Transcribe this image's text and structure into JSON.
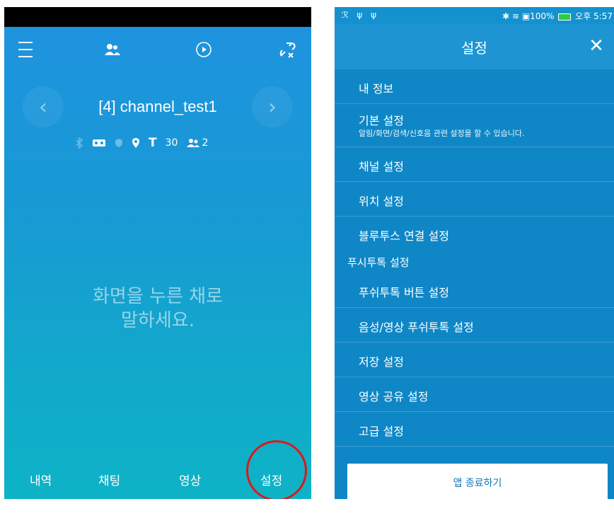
{
  "left": {
    "channel": "[4] channel_test1",
    "status": {
      "t_label": "T",
      "t_value": "30",
      "members": "2"
    },
    "prompt_line1": "화면을 누른 채로",
    "prompt_line2": "말하세요.",
    "tabs": [
      "내역",
      "채팅",
      "영상",
      "설정"
    ]
  },
  "right": {
    "statusbar": {
      "left": "ℛ ψ ψ",
      "right_pre": "✱ ≋ ▣100%",
      "right_post": "오후 5:57"
    },
    "title": "설정",
    "menu": [
      {
        "label": "내 정보"
      },
      {
        "label": "기본 설정",
        "sub": "알림/화면/검색/신호음 관련 설정을 할 수 있습니다."
      },
      {
        "label": "채널 설정"
      },
      {
        "label": "위치 설정"
      },
      {
        "label": "블루투스 연결 설정"
      }
    ],
    "section": "푸시투톡 설정",
    "menu2": [
      {
        "label": "푸쉬투톡 버튼 설정"
      },
      {
        "label": "음성/영상 푸쉬투톡 설정"
      },
      {
        "label": "저장 설정"
      },
      {
        "label": "영상 공유 설정"
      },
      {
        "label": "고급 설정"
      }
    ],
    "exit": "앱 종료하기"
  }
}
